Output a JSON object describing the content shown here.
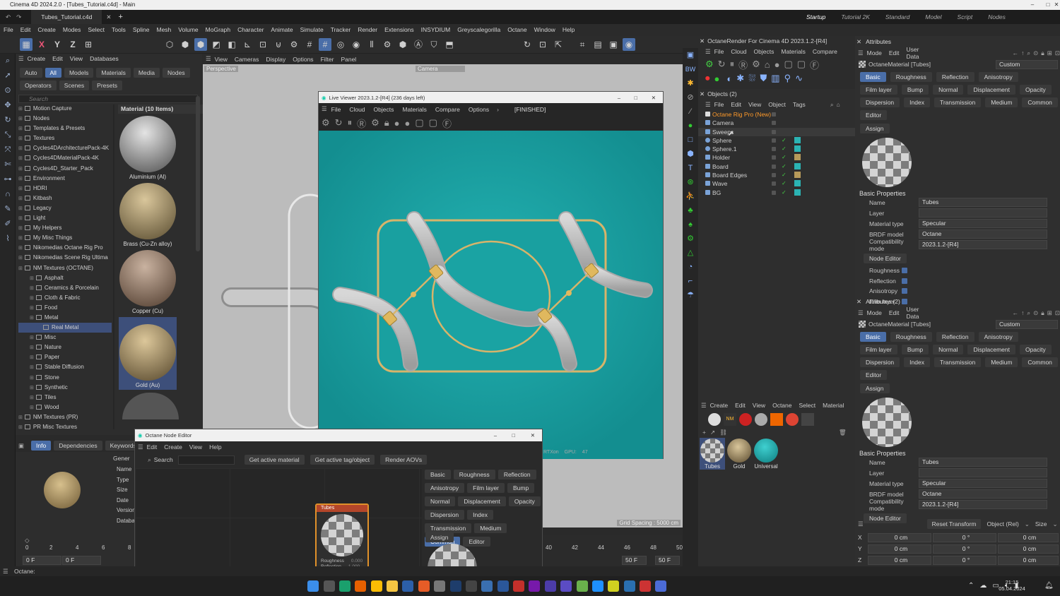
{
  "titlebar": {
    "title": "Cinema 4D 2024.2.0 - [Tubes_Tutorial.c4d] - Main"
  },
  "tabs": {
    "file_tab": "Tubes_Tutorial.c4d",
    "layouts": [
      "Startup",
      "Tutorial 2K",
      "Standard",
      "Model",
      "Script",
      "Nodes"
    ]
  },
  "menu": [
    "File",
    "Edit",
    "Create",
    "Modes",
    "Select",
    "Tools",
    "Spline",
    "Mesh",
    "Volume",
    "MoGraph",
    "Character",
    "Animate",
    "Simulate",
    "Tracker",
    "Render",
    "Extensions",
    "INSYDIUM",
    "Greyscalegorilla",
    "Octane",
    "Window",
    "Help"
  ],
  "toolbar": {
    "axes": [
      "X",
      "Y",
      "Z"
    ]
  },
  "asset": {
    "menu": [
      "Create",
      "Edit",
      "View",
      "Databases"
    ],
    "filters": [
      "Auto",
      "All",
      "Models",
      "Materials",
      "Media",
      "Nodes"
    ],
    "filters2": [
      "Operators",
      "Scenes",
      "Presets"
    ],
    "search_placeholder": "Search",
    "tree": [
      "Motion Capture",
      "Nodes",
      "Templates & Presets",
      "Textures",
      "Cycles4DArchitecturePack-4K",
      "Cycles4DMaterialPack-4K",
      "Cycles4D_Starter_Pack",
      "Environment",
      "HDRI",
      "Kitbash",
      "Legacy",
      "Light",
      "My Helpers",
      "My Misc Things",
      "Nikomedias Octane Rig Pro",
      "Nikomedias Scene Rig Ultima",
      "NM Textures (OCTANE)",
      "Asphalt",
      "Ceramics & Porcelain",
      "Cloth & Fabric",
      "Food",
      "Metal",
      "Real Metal",
      "Misc",
      "Nature",
      "Paper",
      "Stable Diffusion",
      "Stone",
      "Synthetic",
      "Tiles",
      "Wood",
      "NM Textures (PR)",
      "PR Misc Textures"
    ],
    "grid_title": "Material (10 Items)",
    "materials": [
      "Aluminium (Al)",
      "Brass (Cu-Zn alloy)",
      "Copper (Cu)",
      "Gold (Au)"
    ]
  },
  "viewport": {
    "menu": [
      "View",
      "Cameras",
      "Display",
      "Options",
      "Filter",
      "Panel"
    ],
    "label": "Perspective",
    "camera": "Camera",
    "grid": "Grid Spacing : 5000 cm"
  },
  "liveviewer": {
    "title": "Live Viewer 2023.1.2-[R4] (236 days left)",
    "menu": [
      "File",
      "Cloud",
      "Objects",
      "Materials",
      "Compare",
      "Options"
    ],
    "status": "[FINISHED]",
    "rtx": "RTXon",
    "gpu": "GPU:",
    "gpu_val": "47"
  },
  "nodeeditor": {
    "title": "Octane Node Editor",
    "menu": [
      "Edit",
      "Create",
      "View",
      "Help"
    ],
    "search": "Search",
    "buttons": [
      "Get active material",
      "Get active tag/object",
      "Render AOVs"
    ],
    "tabs": [
      "Basic",
      "Roughness",
      "Reflection",
      "Anisotropy",
      "Film layer",
      "Bump",
      "Normal",
      "Displacement",
      "Opacity",
      "Dispersion",
      "Index",
      "Transmission",
      "Medium",
      "Common",
      "Editor"
    ],
    "assign": "Assign",
    "node": {
      "name": "Tubes",
      "ports": [
        "Roughness",
        "Reflection",
        "Rotation"
      ],
      "vals": [
        "0.000",
        "1.000",
        ""
      ]
    }
  },
  "info": {
    "tabs": [
      "Info",
      "Dependencies",
      "Keywords"
    ],
    "gen": "Gener",
    "fields": [
      "Name",
      "Type",
      "Size",
      "Date",
      "Version",
      "Databa"
    ]
  },
  "timeline": {
    "ticks": [
      "0",
      "2",
      "4",
      "6",
      "8",
      "40",
      "42",
      "44",
      "46",
      "48",
      "50"
    ],
    "frame_start": "0 F",
    "frame_cur": "0 F",
    "frame_end": "50 F",
    "frame_end2": "50 F"
  },
  "octane": {
    "title": "OctaneRender For Cinema 4D 2023.1.2-[R4]",
    "menu": [
      "File",
      "Cloud",
      "Objects",
      "Materials",
      "Compare"
    ]
  },
  "objects": {
    "title": "Objects (2)",
    "menu": [
      "File",
      "Edit",
      "View",
      "Object",
      "Tags"
    ],
    "items": [
      "Octane Rig Pro (New)",
      "Camera",
      "Sweeps",
      "Sphere",
      "Sphere.1",
      "Holder",
      "Board",
      "Board Edges",
      "Wave",
      "BG"
    ]
  },
  "matmgr": {
    "menu": [
      "Create",
      "Edit",
      "View",
      "Octane",
      "Select",
      "Material"
    ],
    "mats": [
      "Tubes",
      "Gold",
      "Universal"
    ]
  },
  "attrs": {
    "title": "Attributes",
    "title2": "Attributes (2)",
    "menu": [
      "Mode",
      "Edit",
      "User Data"
    ],
    "mat": "OctaneMaterial [Tubes]",
    "preset": "Custom",
    "tabs": [
      "Basic",
      "Roughness",
      "Reflection",
      "Anisotropy",
      "Film layer",
      "Bump",
      "Normal",
      "Displacement",
      "Opacity",
      "Dispersion",
      "Index",
      "Transmission",
      "Medium",
      "Common",
      "Editor"
    ],
    "assign": "Assign",
    "section": "Basic Properties",
    "props": [
      {
        "label": "Name",
        "value": "Tubes"
      },
      {
        "label": "Layer",
        "value": ""
      },
      {
        "label": "Material type",
        "value": "Specular"
      },
      {
        "label": "BRDF model",
        "value": "Octane"
      },
      {
        "label": "Compatibility mode",
        "value": "2023.1.2-[R4]"
      }
    ],
    "node_editor": "Node Editor",
    "checks": [
      "Roughness",
      "Reflection",
      "Anisotropy",
      "Film layer"
    ],
    "coords": {
      "reset": "Reset Transform",
      "mode": "Object (Rel)",
      "size": "Size",
      "rows": [
        {
          "a": "X",
          "v1": "0 cm",
          "v2": "0 °",
          "v3": "0 cm"
        },
        {
          "a": "Y",
          "v1": "0 cm",
          "v2": "0 °",
          "v3": "0 cm"
        },
        {
          "a": "Z",
          "v1": "0 cm",
          "v2": "0 °",
          "v3": "0 cm"
        }
      ]
    }
  },
  "status": {
    "text": "Octane:"
  },
  "taskbar": {
    "time": "21:15",
    "date": "05.04.2024"
  }
}
